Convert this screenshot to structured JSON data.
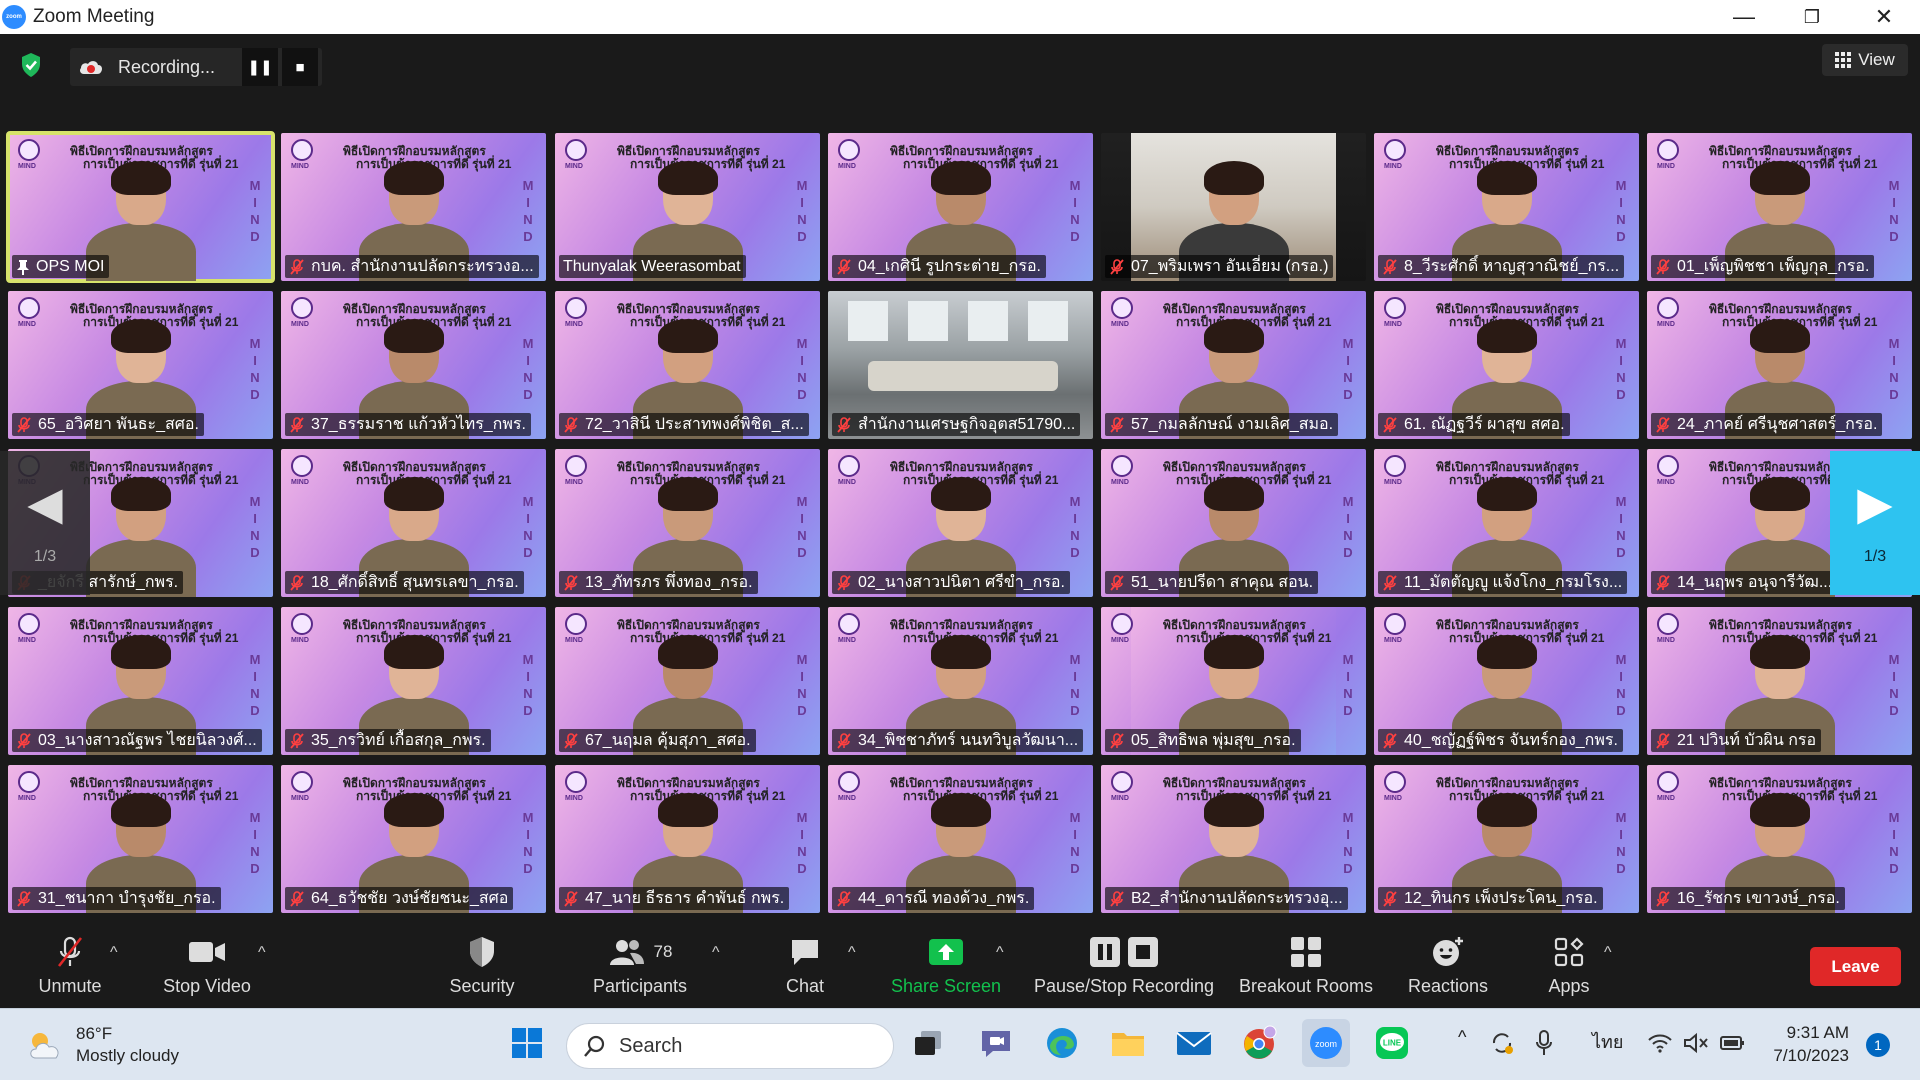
{
  "window": {
    "title": "Zoom Meeting",
    "minimize": "—",
    "maximize": "❐",
    "close": "✕"
  },
  "meeting": {
    "recording_label": "Recording...",
    "pause_symbol": "❚❚",
    "stop_symbol": "■",
    "view_label": "View",
    "page_indicator_left": "1/3",
    "page_indicator_right": "1/3",
    "banner": {
      "line1": "พิธีเปิดการฝึกอบรมหลักสูตร",
      "line2": "การเป็นข้าราชการที่ดี รุ่นที่ 21",
      "logo_text": "MIND",
      "side_letters": [
        "M",
        "I",
        "N",
        "D"
      ]
    },
    "participants": [
      {
        "name": "OPS MOI",
        "muted": false,
        "pinned": true,
        "active": true,
        "style": "banner"
      },
      {
        "name": "กบค. สำนักงานปลัดกระทรวงอ...",
        "muted": true,
        "style": "banner"
      },
      {
        "name": "Thunyalak Weerasombat",
        "muted": false,
        "style": "banner"
      },
      {
        "name": "04_เกศินี รูปกระต่าย_กรอ.",
        "muted": true,
        "style": "banner"
      },
      {
        "name": "07_พริมเพรา อันเอี่ยม (กรอ.)",
        "muted": true,
        "style": "office"
      },
      {
        "name": "8_วีระศักดิ์ หาญสุวาณิชย์_กร...",
        "muted": true,
        "style": "banner"
      },
      {
        "name": "01_เพ็ญพิชชา เพ็ญกุล_กรอ.",
        "muted": true,
        "style": "banner"
      },
      {
        "name": "65_อวิศยา พันธะ_สศอ.",
        "muted": true,
        "style": "banner"
      },
      {
        "name": "37_ธรรมราช แก้วหัวไทร_กพร.",
        "muted": true,
        "style": "banner"
      },
      {
        "name": "72_วาสินี ประสาทพงศ์พิชิต_ส...",
        "muted": true,
        "style": "banner"
      },
      {
        "name": "สำนักงานเศรษฐกิจอุตส51790...",
        "muted": true,
        "style": "room"
      },
      {
        "name": "57_กมลลักษณ์ งามเลิศ_สมอ.",
        "muted": true,
        "style": "banner"
      },
      {
        "name": "61. ณัฏฐวีร์ ผาสุข สศอ.",
        "muted": true,
        "style": "banner"
      },
      {
        "name": "24_ภาคย์ ศรีนุชศาสตร์_กรอ.",
        "muted": true,
        "style": "banner"
      },
      {
        "name": "_ยจักรี สารักษ์_กพร.",
        "muted": true,
        "style": "banner"
      },
      {
        "name": "18_ศักดิ์สิทธิ์ สุนทรเลขา_กรอ.",
        "muted": true,
        "style": "banner"
      },
      {
        "name": "13_ภัทรภร พึ่งทอง_กรอ.",
        "muted": true,
        "style": "banner"
      },
      {
        "name": "02_นางสาวปนิตา ศรีขำ_กรอ.",
        "muted": true,
        "style": "banner"
      },
      {
        "name": "51_นายปรีดา สาคุณ สอน.",
        "muted": true,
        "style": "banner"
      },
      {
        "name": "11_มัตตัญญู แจ้งโกง_กรมโรง...",
        "muted": true,
        "style": "banner"
      },
      {
        "name": "14_นฤพร อนุจารีวัฒ...",
        "muted": true,
        "style": "banner"
      },
      {
        "name": "03_นางสาวณัฐพร ไชยนิลวงศ์...",
        "muted": true,
        "style": "banner"
      },
      {
        "name": "35_กรวิทย์ เกื้อสกุล_กพร.",
        "muted": true,
        "style": "banner"
      },
      {
        "name": "67_นฤมล คุ้มสุภา_สศอ.",
        "muted": true,
        "style": "banner"
      },
      {
        "name": "34_พิชชาภัทร์ นนทวิบูลวัฒนา...",
        "muted": true,
        "style": "banner"
      },
      {
        "name": "05_สิทธิพล พุ่มสุข_กรอ.",
        "muted": true,
        "style": "banner-dark"
      },
      {
        "name": "40_ชญัฏฐ์พิชร จันทร์กอง_กพร.",
        "muted": true,
        "style": "banner"
      },
      {
        "name": "21 ปวินท์ บัวผิน กรอ",
        "muted": true,
        "style": "banner"
      },
      {
        "name": "31_ชนากา บำรุงชัย_กรอ.",
        "muted": true,
        "style": "banner"
      },
      {
        "name": "64_ธวัชชัย วงษ์ชัยชนะ_สศอ",
        "muted": true,
        "style": "banner"
      },
      {
        "name": "47_นาย ธีรธาร คำพันธ์ กพร.",
        "muted": true,
        "style": "banner"
      },
      {
        "name": "44_ดารณี ทองด้วง_กพร.",
        "muted": true,
        "style": "banner"
      },
      {
        "name": "B2_สำนักงานปลัดกระทรวงอุ...",
        "muted": true,
        "style": "banner"
      },
      {
        "name": "12_ทินกร เพ็งประโคน_กรอ.",
        "muted": true,
        "style": "banner"
      },
      {
        "name": "16_รัชกร เขาวงษ์_กรอ.",
        "muted": true,
        "style": "banner"
      }
    ]
  },
  "toolbar": {
    "unmute": "Unmute",
    "stop_video": "Stop Video",
    "security": "Security",
    "participants": "Participants",
    "participants_count": "78",
    "chat": "Chat",
    "share_screen": "Share Screen",
    "pause_stop_recording": "Pause/Stop Recording",
    "breakout_rooms": "Breakout Rooms",
    "reactions": "Reactions",
    "apps": "Apps",
    "leave": "Leave",
    "share_color": "#12c14d",
    "leave_color": "#e02828"
  },
  "taskbar": {
    "temperature": "86°F",
    "weather": "Mostly cloudy",
    "search": "Search",
    "language": "ไทย",
    "time": "9:31 AM",
    "date": "7/10/2023",
    "notifications": "1",
    "apps": [
      "windows-start-icon",
      "task-view-icon",
      "teams-chat-icon",
      "edge-icon",
      "file-explorer-icon",
      "mail-icon",
      "chrome-icon",
      "zoom-icon",
      "line-icon"
    ]
  }
}
